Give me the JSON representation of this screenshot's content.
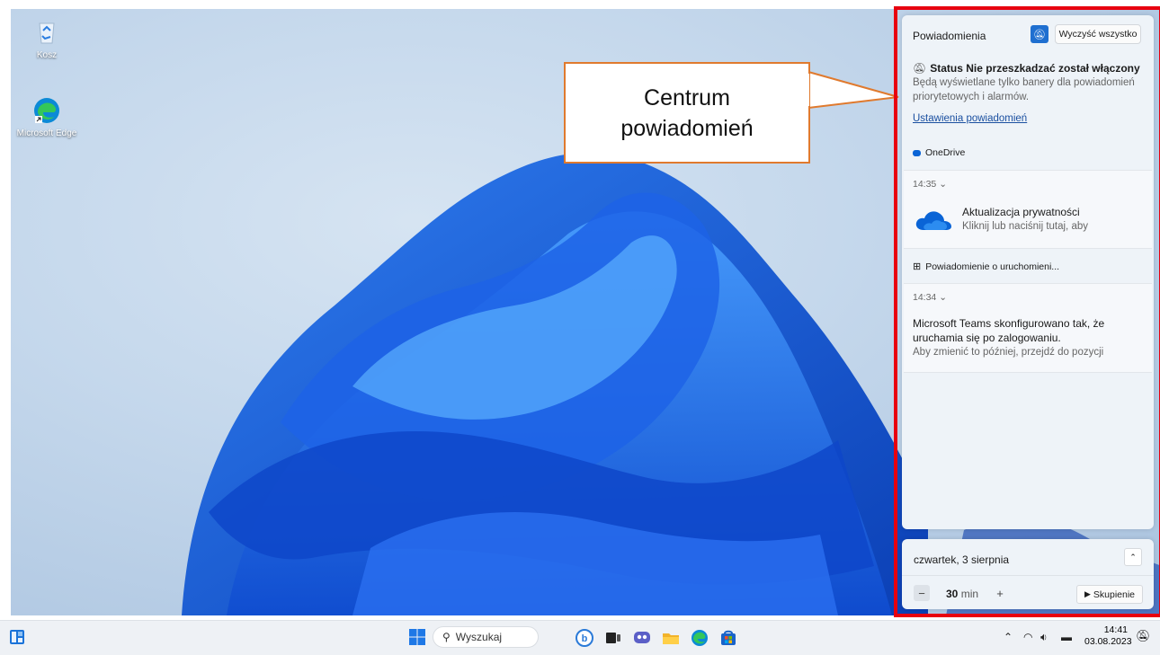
{
  "desktop": {
    "icons": [
      {
        "label": "Kosz",
        "icon": "recycle-bin-icon"
      },
      {
        "label": "Microsoft Edge",
        "icon": "edge-icon"
      }
    ]
  },
  "callout": {
    "line1": "Centrum",
    "line2": "powiadomień"
  },
  "notification_center": {
    "title": "Powiadomienia",
    "clear_all": "Wyczyść wszystko",
    "dnd_status_title": "Status Nie przeszkadzać został włączony",
    "dnd_status_body": "Będą wyświetlane tylko banery dla powiadomień priorytetowych i alarmów.",
    "settings_link": "Ustawienia powiadomień",
    "groups": [
      {
        "app": "OneDrive",
        "time": "14:35",
        "title": "Aktualizacja prywatności",
        "body": "Kliknij lub naciśnij tutaj, aby"
      },
      {
        "app": "Powiadomienie o uruchomieni...",
        "time": "14:34",
        "title": "Microsoft Teams skonfigurowano tak, że uruchamia się po zalogowaniu.",
        "body": "Aby zmienić to później, przejdź do pozycji"
      }
    ]
  },
  "calendar": {
    "date": "czwartek, 3 sierpnia",
    "focus_minutes": "30",
    "focus_unit": "min",
    "focus_button": "Skupienie"
  },
  "taskbar": {
    "search_placeholder": "Wyszukaj",
    "time": "14:41",
    "date": "03.08.2023"
  },
  "colors": {
    "accent": "#1f6fd0",
    "highlight_frame": "#e8000f",
    "callout_border": "#e07a2e"
  }
}
